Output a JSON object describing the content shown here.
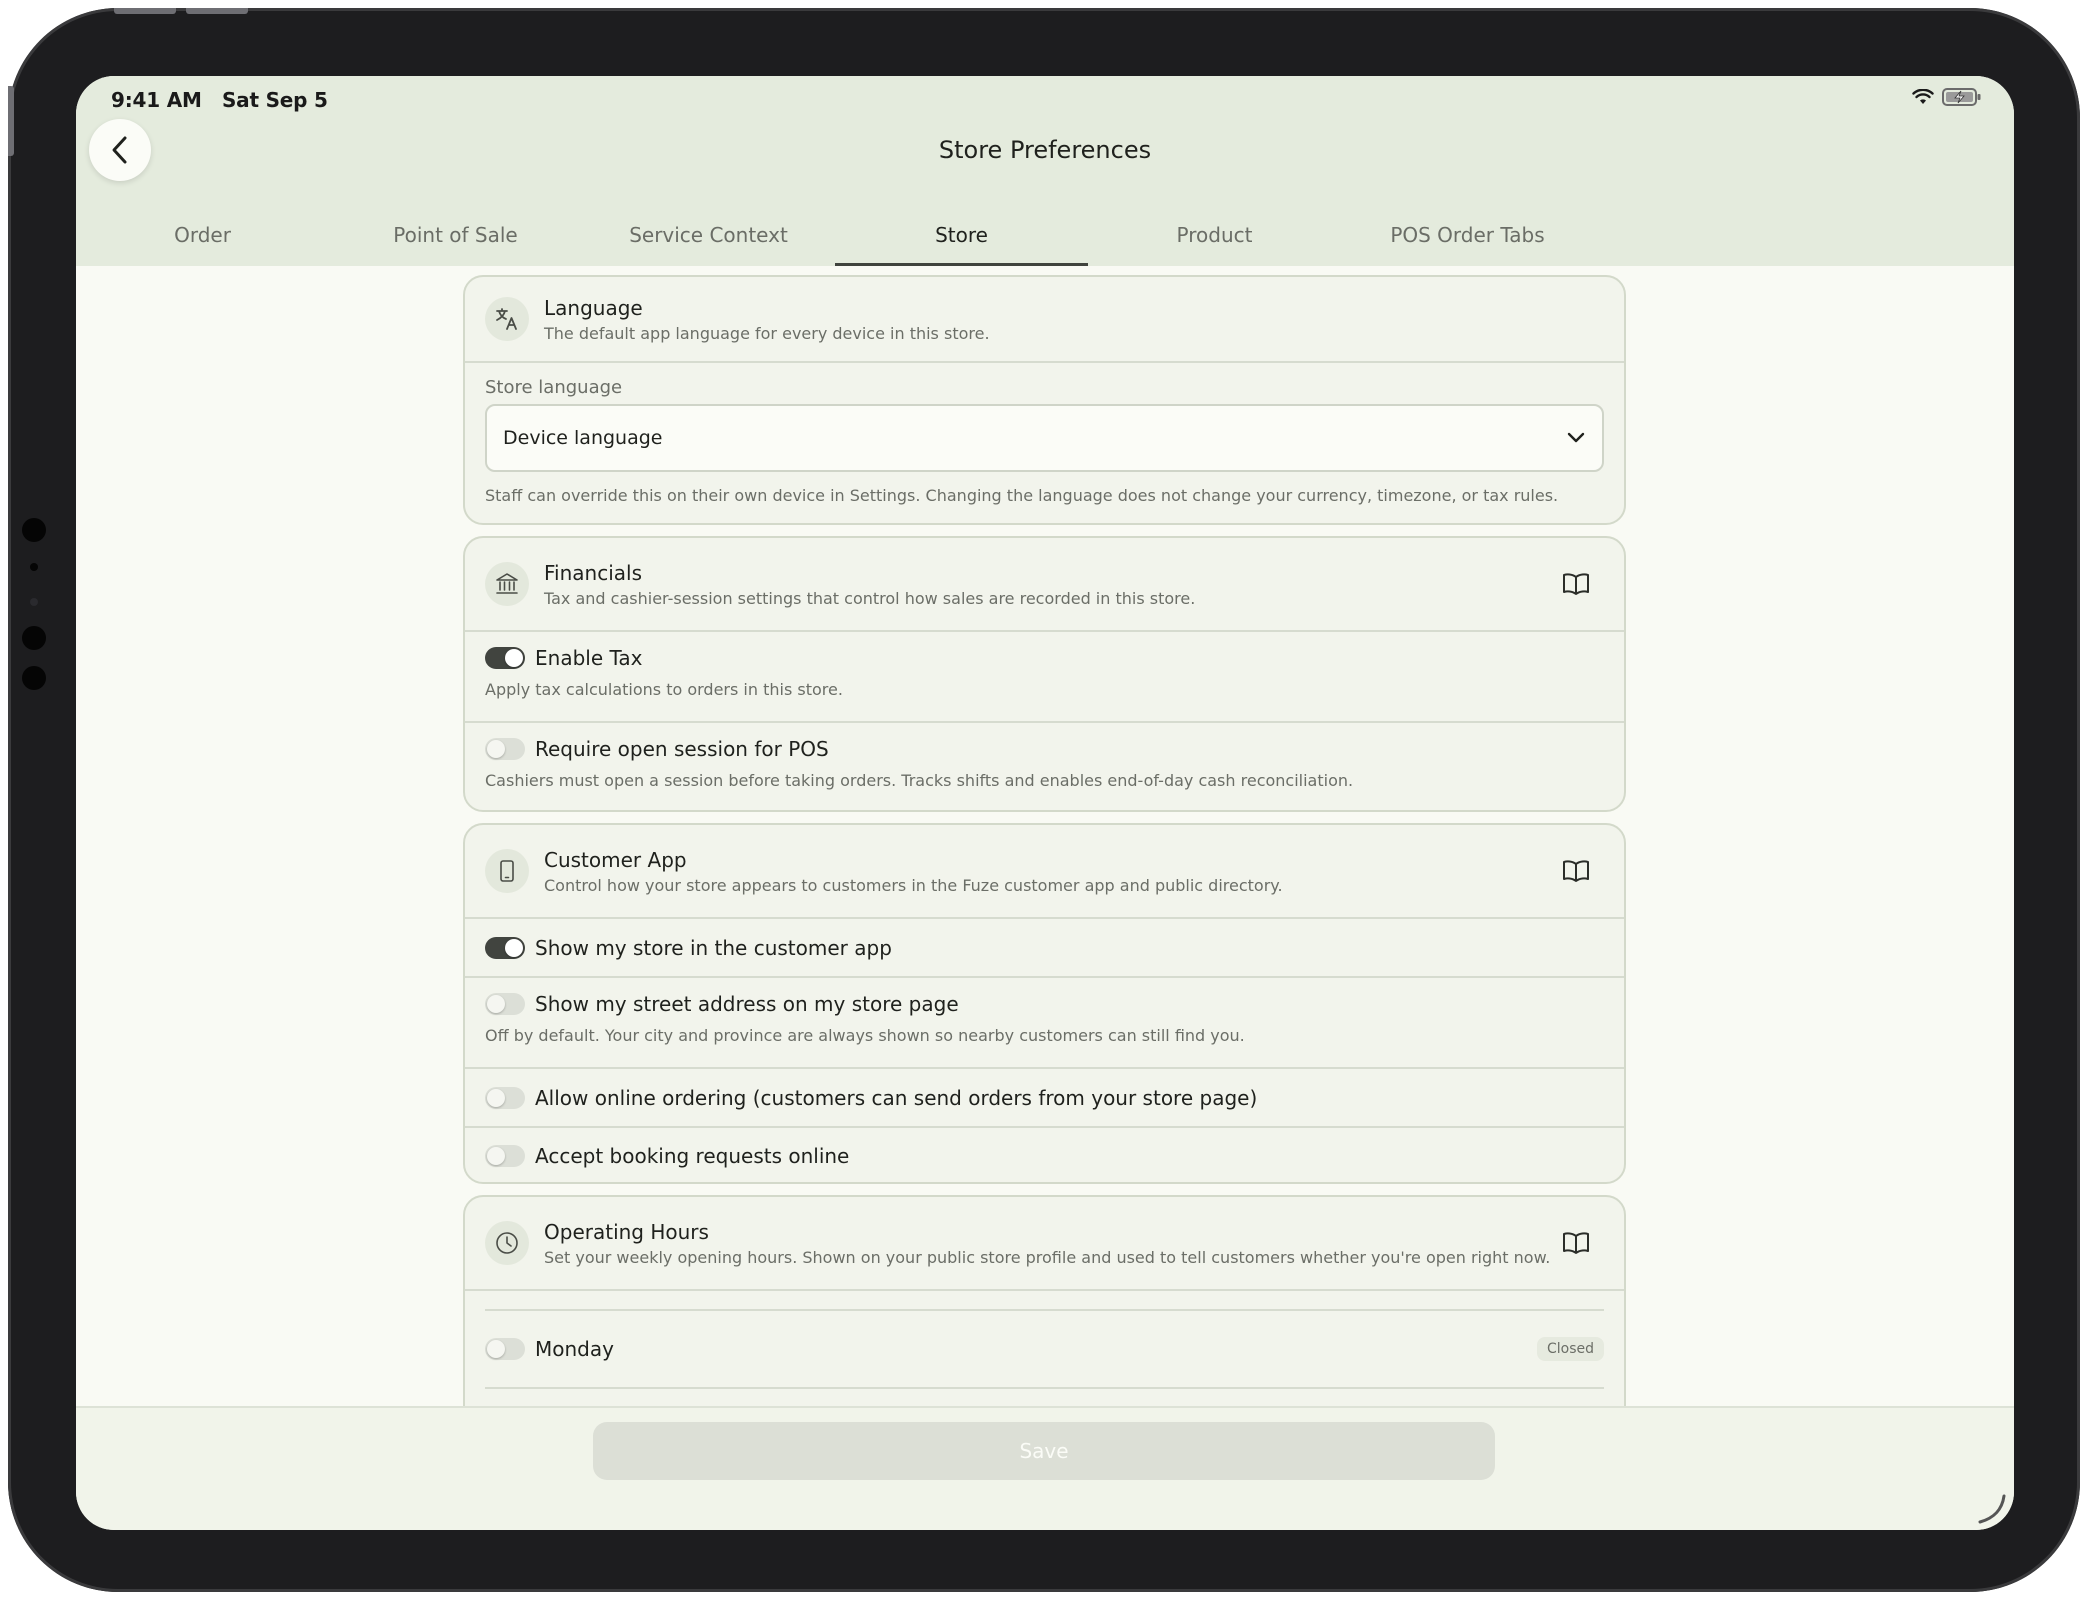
{
  "status_bar": {
    "time": "9:41 AM   Sat Sep 5"
  },
  "header": {
    "title": "Store Preferences",
    "tabs": [
      {
        "label": "Order"
      },
      {
        "label": "Point of Sale"
      },
      {
        "label": "Service Context"
      },
      {
        "label": "Store",
        "active": true
      },
      {
        "label": "Product"
      },
      {
        "label": "POS Order Tabs"
      }
    ]
  },
  "language": {
    "title": "Language",
    "subtitle": "The default app language for every device in this store.",
    "field_label": "Store language",
    "selected": "Device language",
    "help": "Staff can override this on their own device in Settings. Changing the language does not change your currency, timezone, or tax rules."
  },
  "financials": {
    "title": "Financials",
    "subtitle": "Tax and cashier-session settings that control how sales are recorded in this store.",
    "enable_tax": {
      "label": "Enable Tax",
      "desc": "Apply tax calculations to orders in this store.",
      "on": true
    },
    "require_session": {
      "label": "Require open session for POS",
      "desc": "Cashiers must open a session before taking orders. Tracks shifts and enables end-of-day cash reconciliation.",
      "on": false
    }
  },
  "customer_app": {
    "title": "Customer App",
    "subtitle": "Control how your store appears to customers in the Fuze customer app and public directory.",
    "show_store": {
      "label": "Show my store in the customer app",
      "on": true
    },
    "show_address": {
      "label": "Show my street address on my store page",
      "desc": "Off by default. Your city and province are always shown so nearby customers can still find you.",
      "on": false
    },
    "online_ordering": {
      "label": "Allow online ordering (customers can send orders from your store page)",
      "on": false
    },
    "booking": {
      "label": "Accept booking requests online",
      "on": false
    }
  },
  "operating_hours": {
    "title": "Operating Hours",
    "subtitle": "Set your weekly opening hours. Shown on your public store profile and used to tell customers whether you're open right now.",
    "monday": {
      "label": "Monday",
      "status": "Closed",
      "on": false
    }
  },
  "footer": {
    "save_label": "Save"
  },
  "colors": {
    "header_bg": "#e4ebdd",
    "page_bg": "#f9faf4",
    "toggle_on": "#41443f",
    "save_disabled": "#dcdfd6"
  }
}
